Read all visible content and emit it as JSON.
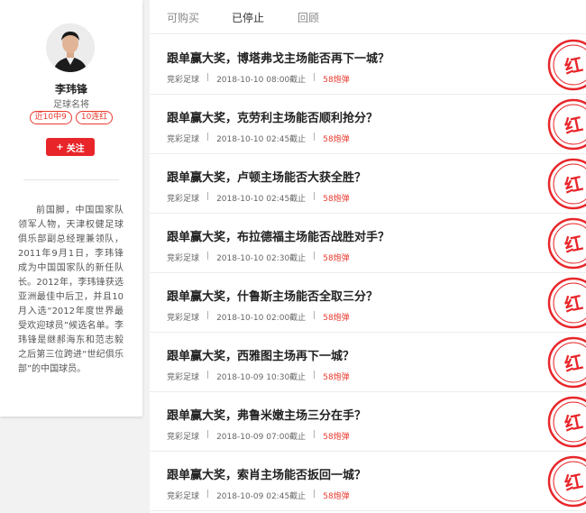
{
  "expert": {
    "name": "李玮锋",
    "title": "足球名将",
    "badges": [
      "近10中9",
      "10连红"
    ],
    "follow_label": "关注",
    "bio": "前国脚，中国国家队领军人物，天津权健足球俱乐部副总经理兼领队，2011年9月1日，李玮锋成为中国国家队的新任队长。2012年，李玮锋获选亚洲最佳中后卫，并且10月入选“2012年度世界最受欢迎球员”候选名单。李玮锋是继郝海东和范志毅之后第三位跨进“世纪俱乐部”的中国球员。"
  },
  "tabs": [
    {
      "label": "可购买",
      "active": false
    },
    {
      "label": "已停止",
      "active": true
    },
    {
      "label": "回顾",
      "active": false
    }
  ],
  "stamp_text": "红",
  "articles": [
    {
      "title": "跟单赢大奖，博塔弗戈主场能否再下一城？",
      "category": "竞彩足球",
      "deadline": "2018-10-10 08:00截止",
      "price": "58炮弹"
    },
    {
      "title": "跟单赢大奖，克劳利主场能否顺利抢分？",
      "category": "竞彩足球",
      "deadline": "2018-10-10 02:45截止",
      "price": "58炮弹"
    },
    {
      "title": "跟单赢大奖，卢顿主场能否大获全胜？",
      "category": "竞彩足球",
      "deadline": "2018-10-10 02:45截止",
      "price": "58炮弹"
    },
    {
      "title": "跟单赢大奖，布拉德福主场能否战胜对手？",
      "category": "竞彩足球",
      "deadline": "2018-10-10 02:30截止",
      "price": "58炮弹"
    },
    {
      "title": "跟单赢大奖，什鲁斯主场能否全取三分？",
      "category": "竞彩足球",
      "deadline": "2018-10-10 02:00截止",
      "price": "58炮弹"
    },
    {
      "title": "跟单赢大奖，西雅图主场再下一城？",
      "category": "竞彩足球",
      "deadline": "2018-10-09 10:30截止",
      "price": "58炮弹"
    },
    {
      "title": "跟单赢大奖，弗鲁米嫩主场三分在手？",
      "category": "竞彩足球",
      "deadline": "2018-10-09 07:00截止",
      "price": "58炮弹"
    },
    {
      "title": "跟单赢大奖，索肖主场能否扳回一城？",
      "category": "竞彩足球",
      "deadline": "2018-10-09 02:45截止",
      "price": "58炮弹"
    }
  ]
}
